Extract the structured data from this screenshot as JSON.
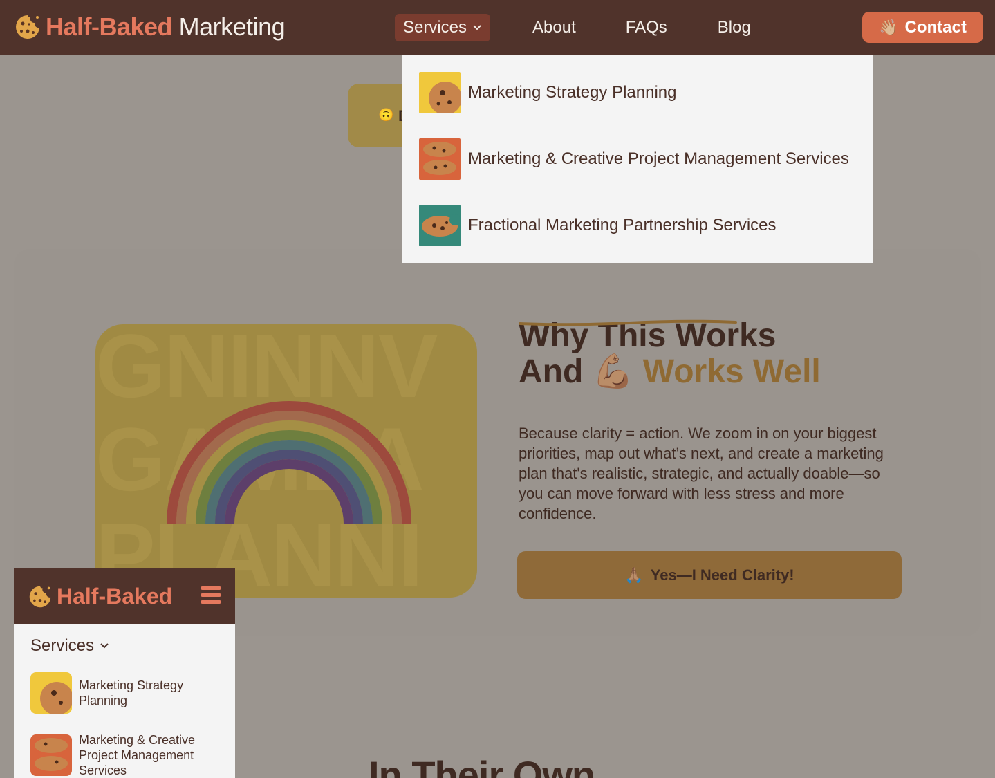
{
  "brand": {
    "name_part1": "Half-Baked",
    "name_part2": "Marketing",
    "colors": {
      "nav_bg": "#50332b",
      "accent": "#e5795e",
      "contact": "#d66a48",
      "dropdown_bg": "#f4f4f4"
    }
  },
  "nav": {
    "services_label": "Services",
    "about_label": "About",
    "faqs_label": "FAQs",
    "blog_label": "Blog",
    "contact_label": "Contact",
    "contact_emoji": "👋🏼"
  },
  "dropdown": {
    "items": [
      {
        "label": "Marketing Strategy Planning",
        "thumb_color": "#f0c83c",
        "icon": "cookie-image"
      },
      {
        "label": "Marketing & Creative Project Management Services",
        "thumb_color": "#d8643c",
        "icon": "two-cookies-image"
      },
      {
        "label": "Fractional Marketing Partnership Services",
        "thumb_color": "#35897a",
        "icon": "bitten-cookie-image"
      }
    ]
  },
  "background_page": {
    "pill_emoji": "🙃",
    "pill_letter": "D",
    "image_words": [
      "GNINNV",
      "GAMEA",
      "PLANNI"
    ],
    "why": {
      "title_line1": "Why This Works",
      "title_line2_prefix": "And",
      "title_emoji": "💪🏽",
      "title_highlight": "Works Well",
      "body": "Because clarity = action. We zoom in on your biggest priorities, map out what’s next, and create a marketing plan that's realistic, strategic, and actually doable—so you can move forward with less stress and more confidence.",
      "cta_emoji": "🙏🏽",
      "cta_label": "Yes—I Need Clarity!"
    },
    "next_heading": "In Their Own"
  },
  "mobile_menu": {
    "brand": "Half-Baked",
    "services_label": "Services",
    "items": [
      {
        "label": "Marketing Strategy Planning"
      },
      {
        "label": "Marketing & Creative Project Management Services"
      }
    ]
  }
}
